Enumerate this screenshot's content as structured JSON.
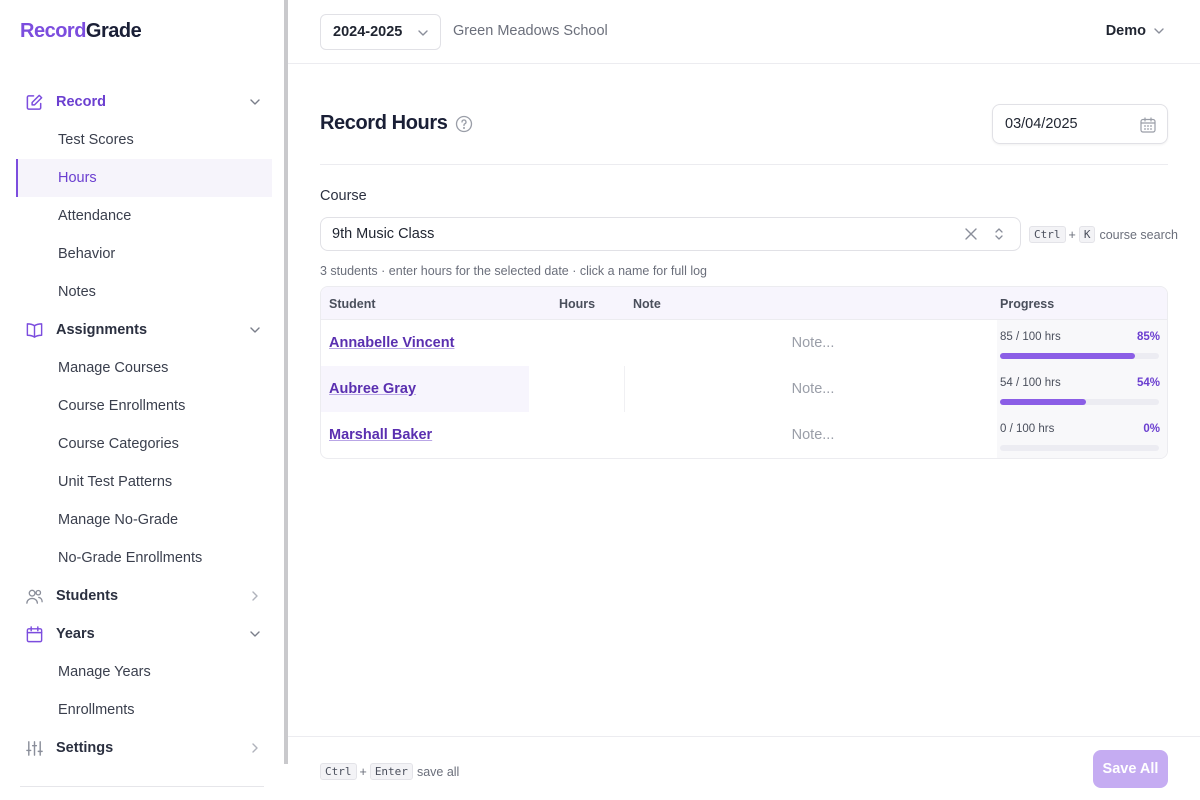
{
  "app": {
    "logo_part1": "Record",
    "logo_part2": "Grade"
  },
  "header": {
    "year": "2024-2025",
    "school": "Green Meadows School",
    "user": "Demo"
  },
  "sidebar": {
    "groups": [
      {
        "label": "Record",
        "icon": "edit-icon",
        "items": [
          "Test Scores",
          "Hours",
          "Attendance",
          "Behavior",
          "Notes"
        ]
      },
      {
        "label": "Assignments",
        "icon": "book-icon",
        "items": [
          "Manage Courses",
          "Course Enrollments",
          "Course Categories",
          "Unit Test Patterns",
          "Manage No-Grade",
          "No-Grade Enrollments"
        ]
      },
      {
        "label": "Students",
        "icon": "users-icon",
        "items": []
      },
      {
        "label": "Years",
        "icon": "calendar-icon",
        "items": [
          "Manage Years",
          "Enrollments"
        ]
      },
      {
        "label": "Settings",
        "icon": "sliders-icon",
        "items": []
      }
    ],
    "selected_item": "Hours"
  },
  "page": {
    "title": "Record Hours",
    "date": "03/04/2025",
    "course_label": "Course",
    "course_value": "9th Music Class",
    "shortcut": {
      "key1": "Ctrl",
      "plus": "+",
      "key2": "K",
      "text": "course search"
    },
    "caption": "3 students · enter hours for the selected date · click a name for full log"
  },
  "table": {
    "columns": {
      "student": "Student",
      "hours": "Hours",
      "note": "Note",
      "progress": "Progress"
    },
    "note_placeholder": "Note...",
    "rows": [
      {
        "student": "Annabelle Vincent",
        "progress_text": "85 / 100 hrs",
        "progress_pct": "85%",
        "progress": 0.85
      },
      {
        "student": "Aubree Gray",
        "progress_text": "54 / 100 hrs",
        "progress_pct": "54%",
        "progress": 0.54
      },
      {
        "student": "Marshall Baker",
        "progress_text": "0 / 100 hrs",
        "progress_pct": "0%",
        "progress": 0
      }
    ]
  },
  "footer": {
    "key1": "Ctrl",
    "plus": "+",
    "key2": "Enter",
    "text": "save all",
    "save_label": "Save All"
  },
  "colors": {
    "accent": "#7c4dde",
    "accent_dark": "#6b3fd0",
    "save_disabled": "#c5acf2"
  }
}
